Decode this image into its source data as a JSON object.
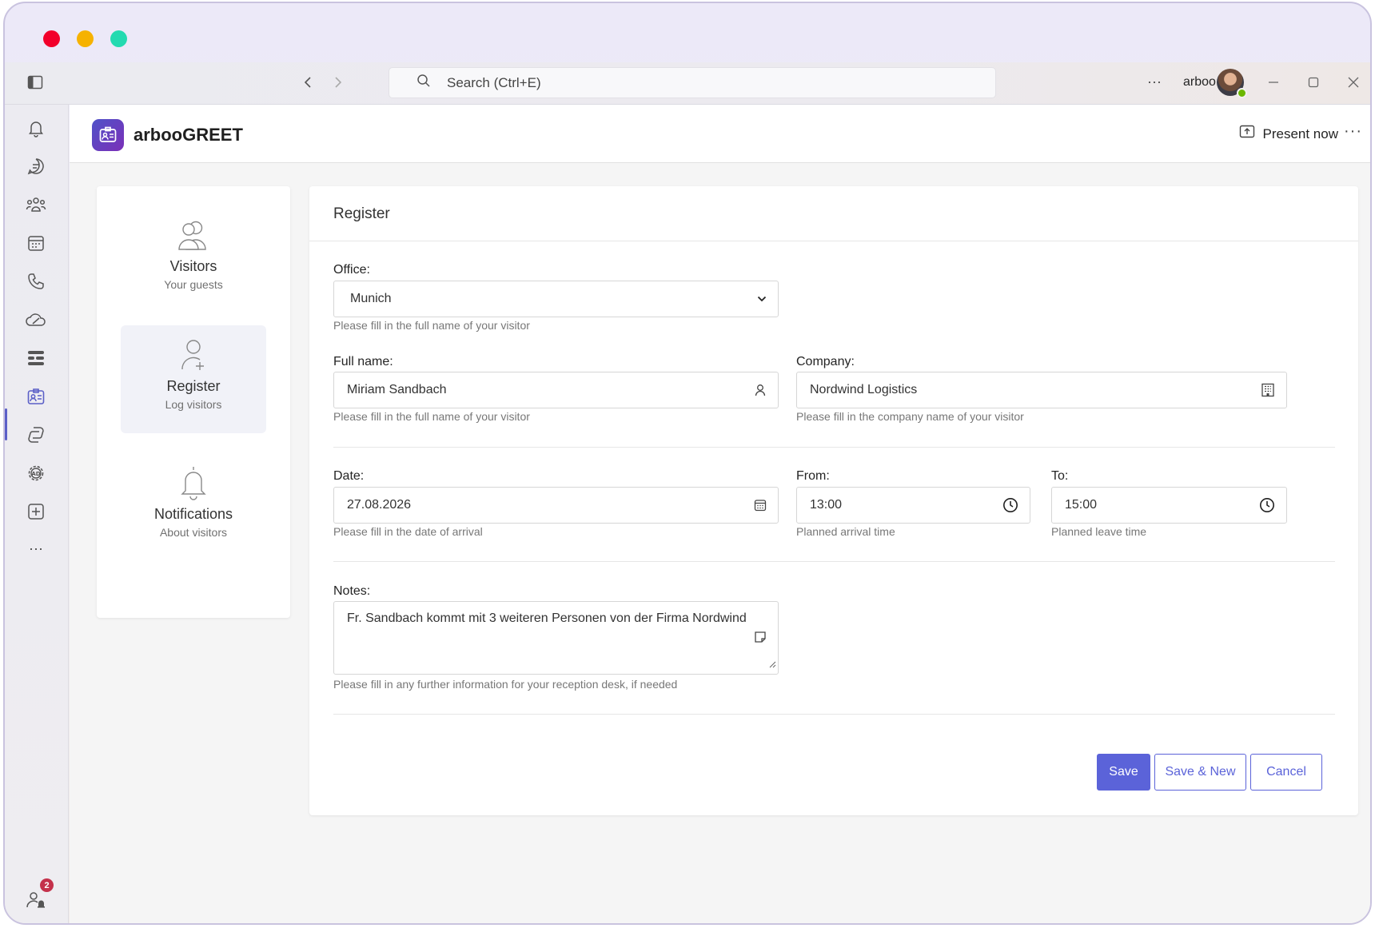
{
  "titlebar": {
    "search_placeholder": "Search (Ctrl+E)",
    "more": "···",
    "user_name": "arboo"
  },
  "rail": {
    "badge_count": "2",
    "more": "···"
  },
  "app": {
    "title": "arbooGREET",
    "present_label": "Present now",
    "more": "···"
  },
  "sidenav": {
    "items": [
      {
        "label": "Visitors",
        "sub": "Your guests",
        "icon": "people-icon",
        "active": false
      },
      {
        "label": "Register",
        "sub": "Log visitors",
        "icon": "person-add-icon",
        "active": true
      },
      {
        "label": "Notifications",
        "sub": "About visitors",
        "icon": "bell-icon",
        "active": false
      }
    ]
  },
  "form": {
    "title": "Register",
    "office": {
      "label": "Office:",
      "value": "Munich",
      "help": "Please fill in the full name of your visitor"
    },
    "full_name": {
      "label": "Full name:",
      "value": "Miriam Sandbach",
      "help": "Please fill in the full name of your visitor"
    },
    "company": {
      "label": "Company:",
      "value": "Nordwind Logistics",
      "help": "Please fill in the company name of your visitor"
    },
    "date": {
      "label": "Date:",
      "value": "27.08.2026",
      "help": "Please fill in the date of arrival"
    },
    "from": {
      "label": "From:",
      "value": "13:00",
      "help": "Planned arrival time"
    },
    "to": {
      "label": "To:",
      "value": "15:00",
      "help": "Planned leave time"
    },
    "notes": {
      "label": "Notes:",
      "value": "Fr. Sandbach kommt mit 3 weiteren Personen von der Firma Nordwind",
      "help": "Please fill in any further information for your reception desk, if needed"
    },
    "buttons": {
      "save": "Save",
      "save_new": "Save & New",
      "cancel": "Cancel"
    }
  },
  "colors": {
    "accent": "#5b63d9",
    "traffic_red": "#f2002b",
    "traffic_yellow": "#f6b200",
    "traffic_green": "#23dab0",
    "badge": "#c4314b",
    "presence": "#6bb700"
  }
}
